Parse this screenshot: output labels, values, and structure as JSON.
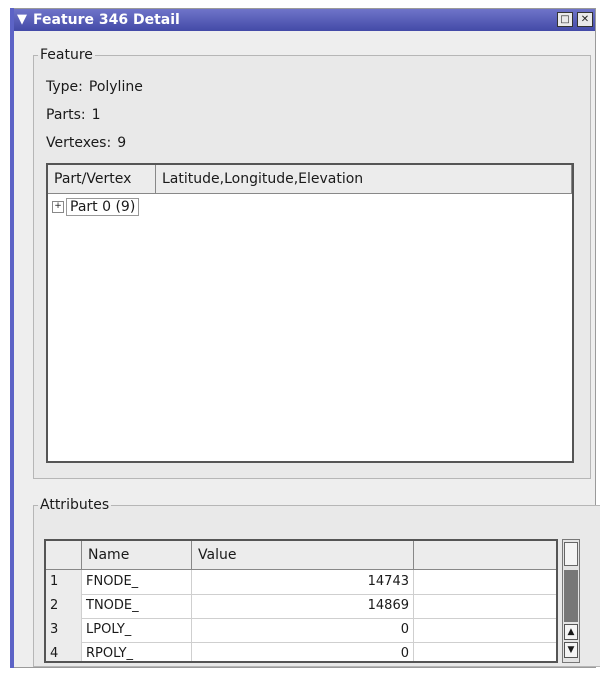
{
  "window": {
    "title": "Feature 346 Detail",
    "accent_color": "#4a50b0",
    "icons": {
      "menu": "chevron-down-icon",
      "maximize": "maximize-icon",
      "close": "close-icon"
    }
  },
  "feature": {
    "legend": "Feature",
    "type_label": "Type:",
    "type_value": "Polyline",
    "parts_label": "Parts:",
    "parts_value": "1",
    "vertexes_label": "Vertexes:",
    "vertexes_value": "9",
    "tree": {
      "columns": [
        "Part/Vertex",
        "Latitude,Longitude,Elevation"
      ],
      "nodes": [
        {
          "label": "Part 0 (9)"
        }
      ]
    }
  },
  "attributes": {
    "legend": "Attributes",
    "columns": [
      "",
      "Name",
      "Value"
    ],
    "rows": [
      {
        "num": "1",
        "name": "FNODE_",
        "value": "14743"
      },
      {
        "num": "2",
        "name": "TNODE_",
        "value": "14869"
      },
      {
        "num": "3",
        "name": "LPOLY_",
        "value": "0"
      },
      {
        "num": "4",
        "name": "RPOLY_",
        "value": "0"
      }
    ]
  }
}
